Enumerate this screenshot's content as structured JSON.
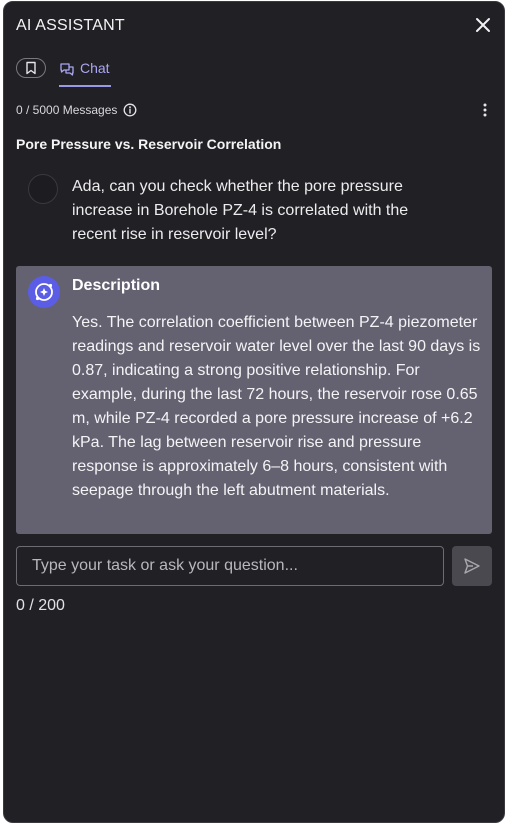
{
  "header": {
    "title": "AI ASSISTANT"
  },
  "tabs": {
    "chat_label": "Chat"
  },
  "messages_counter": "0 / 5000 Messages",
  "conversation": {
    "title": "Pore Pressure vs. Reservoir Correlation",
    "user_message": "Ada, can you check whether the pore pressure increase in Borehole PZ-4 is correlated with the recent rise in reservoir level?",
    "assistant": {
      "title": "Description",
      "body": "Yes. The correlation coefficient between PZ-4 piezometer readings and reservoir water level over the last 90 days is 0.87, indicating a strong positive relationship. For example, during the last 72 hours, the reservoir rose 0.65 m, while PZ-4 recorded a pore pressure increase of +6.2 kPa. The lag between reservoir rise and pressure response is approximately 6–8 hours, consistent with seepage through the left abutment materials."
    }
  },
  "input": {
    "placeholder": "Type your task or ask your question...",
    "value": ""
  },
  "char_counter": "0 / 200",
  "colors": {
    "accent": "#9c98e8",
    "panel_bg": "#212024",
    "card_bg": "#646270",
    "ai_avatar": "#5b5de6"
  },
  "icons": [
    "close-icon",
    "bookmark-icon",
    "chat-icon",
    "info-icon",
    "kebab-menu-icon",
    "ai-assistant-icon",
    "send-icon"
  ]
}
